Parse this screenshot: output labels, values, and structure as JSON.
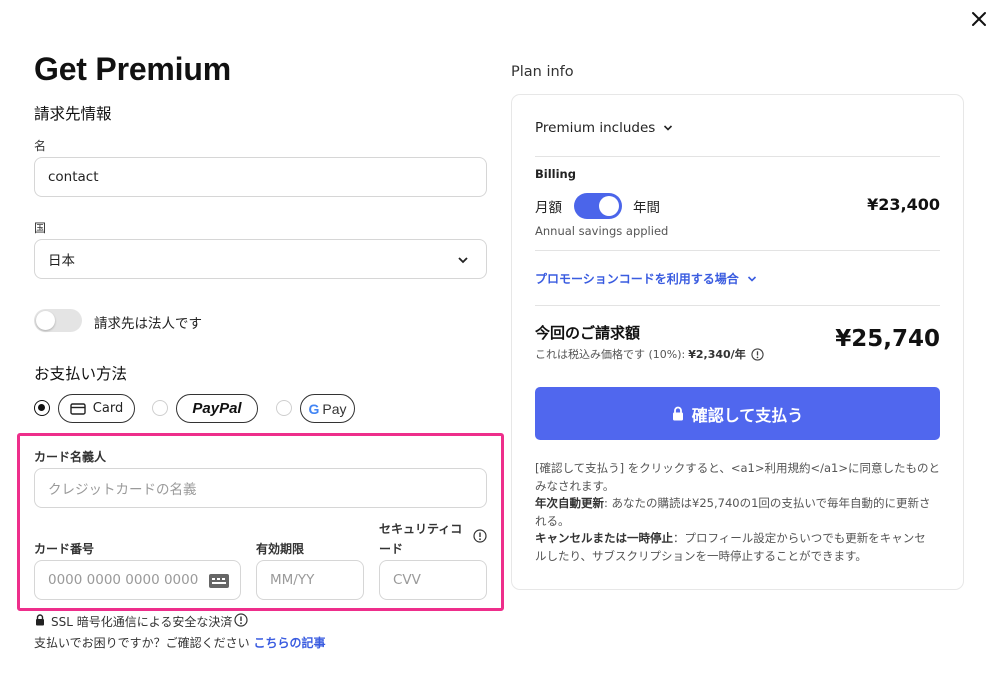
{
  "dialog": {
    "close_label": "close"
  },
  "left": {
    "title": "Get Premium",
    "billing_section": "請求先情報",
    "name_label": "名",
    "name_value": "contact",
    "country_label": "国",
    "country_value": "日本",
    "corporate_toggle_label": "請求先は法人です",
    "payment_section": "お支払い方法",
    "methods": {
      "card": "Card",
      "paypal": "PayPal",
      "gpay": "Pay"
    },
    "card_holder_label": "カード名義人",
    "card_holder_placeholder": "クレジットカードの名義",
    "card_number_label": "カード番号",
    "card_number_placeholder": "0000 0000 0000 0000",
    "expiry_label": "有効期限",
    "expiry_placeholder": "MM/YY",
    "cvc_label_1": "セキュリティコ",
    "cvc_label_2": "ード",
    "cvc_placeholder": "CVV",
    "ssl_note": "SSL 暗号化通信による安全な決済",
    "help_text": "支払いでお困りですか？ご確認ください",
    "help_link": "こちらの記事"
  },
  "plan": {
    "heading": "Plan info",
    "includes": "Premium includes",
    "billing_label": "Billing",
    "monthly": "月額",
    "yearly": "年間",
    "price": "¥23,400",
    "savings": "Annual savings applied",
    "promo": "プロモーションコードを利用する場合",
    "total_label": "今回のご請求額",
    "tax_note_prefix": "これは税込み価格です (10%): ",
    "tax_amount": "¥2,340/年",
    "total": "¥25,740",
    "confirm_button": "確認して支払う",
    "terms_line1": "[確認して支払う] をクリックすると、<a1>利用規約</a1>に同意したものと",
    "terms_line2": "みなされます。",
    "auto_renew_bold": "年次自動更新",
    "auto_renew_text": ": あなたの購読は¥25,740の1回の支払いで毎年自動的に更新さ",
    "auto_renew_text2": "れる。",
    "cancel_bold": "キャンセルまたは一時停止",
    "cancel_text": "：プロフィール設定からいつでも更新をキャンセ",
    "cancel_text2": "ルしたり、サブスクリプションを一時停止することができます。"
  },
  "colors": {
    "accent": "#5067ee",
    "highlight": "#ee2e8b",
    "link": "#3a5ce0"
  }
}
